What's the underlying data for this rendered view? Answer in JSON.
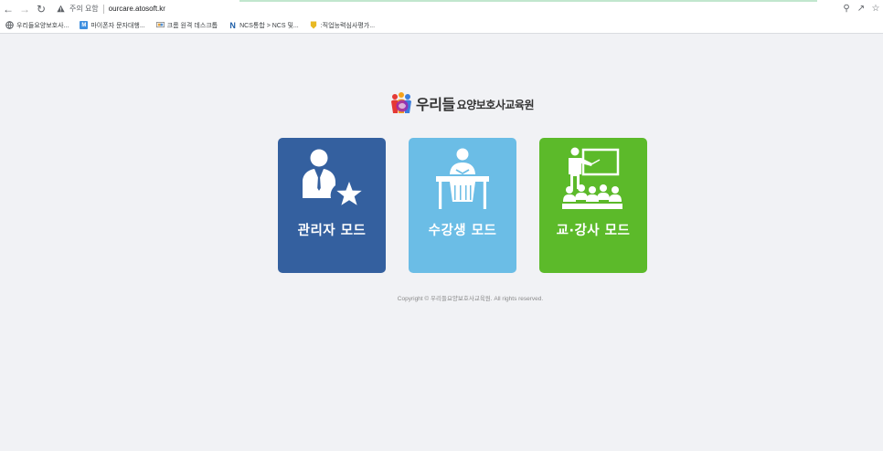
{
  "browser": {
    "url": "ourcare.atosoft.kr",
    "security_label": "주의 요함",
    "bookmarks": [
      {
        "label": "우리들요양보호사...",
        "icon": "globe-icon"
      },
      {
        "label": "마이폰자 문자대행...",
        "icon": "app-icon"
      },
      {
        "label": "크롬 원격 데스크톱",
        "icon": "remote-desktop-icon"
      },
      {
        "label": "NCS통합 > NCS 및...",
        "icon": "ncs-icon"
      },
      {
        "label": ":직업능력심사평가...",
        "icon": "badge-icon"
      }
    ]
  },
  "logo": {
    "name": "우리들",
    "subtitle": "요양보호사교육원",
    "icon": "people-logo-icon"
  },
  "modes": [
    {
      "label": "관리자 모드",
      "icon": "admin-star-icon",
      "color": "#34609f"
    },
    {
      "label": "수강생 모드",
      "icon": "student-desk-icon",
      "color": "#6bbde6"
    },
    {
      "label": "교·강사 모드",
      "icon": "teacher-board-icon",
      "color": "#5cba2a"
    }
  ],
  "footer": {
    "copyright": "Copyright © 우리들요양보호사교육원. All rights reserved."
  }
}
